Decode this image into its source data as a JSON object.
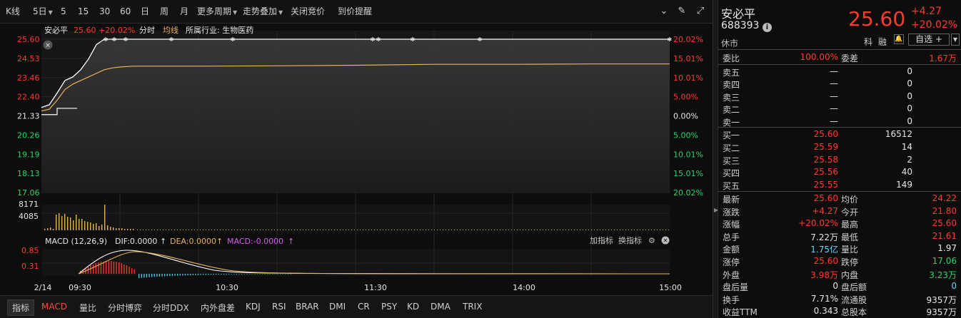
{
  "toolbar": {
    "items": [
      "K线",
      "5日",
      "5",
      "15",
      "30",
      "60",
      "日",
      "周",
      "月",
      "更多周期",
      "走势叠加",
      "关闭竞价",
      "到价提醒"
    ]
  },
  "chart_header": {
    "name": "安必平",
    "price": "25.60",
    "pct": "+20.02%",
    "mode": "分时",
    "avg_label": "均线",
    "industry": "所属行业: 生物医药"
  },
  "axes": {
    "price_ticks": [
      "25.60",
      "24.53",
      "23.46",
      "22.40",
      "21.33",
      "20.26",
      "19.19",
      "18.13",
      "17.06"
    ],
    "pct_ticks": [
      "20.02%",
      "15.01%",
      "10.01%",
      "5.00%",
      "0.00%",
      "5.00%",
      "10.01%",
      "15.01%",
      "20.02%"
    ],
    "vol_ticks": [
      "8171",
      "4085"
    ],
    "macd_ticks": [
      "0.85",
      "0.31"
    ],
    "time_ticks": [
      "2/14",
      "09:30",
      "10:30",
      "11:30",
      "14:00",
      "15:00"
    ]
  },
  "macd": {
    "title": "MACD (12,26,9)",
    "dif": "DIF:0.0000",
    "dea": "DEA:0.0000",
    "macd": "MACD:-0.0000",
    "add_indicator": "加指标",
    "switch_indicator": "换指标"
  },
  "tabs": [
    "指标",
    "MACD",
    "量比",
    "分时博弈",
    "分时DDX",
    "内外盘差",
    "KDJ",
    "RSI",
    "BRAR",
    "DMI",
    "CR",
    "PSY",
    "KD",
    "DMA",
    "TRIX"
  ],
  "panel": {
    "name": "安必平",
    "code": "688393",
    "status": "休市",
    "price": "25.60",
    "change": "+4.27",
    "change_pct": "+20.02%",
    "badge_ke": "科",
    "badge_rong": "融",
    "watch": "自选 +",
    "weibi_label": "委比",
    "weibi": "100.00%",
    "weicha_label": "委差",
    "weicha": "1.67万",
    "asks": [
      {
        "label": "卖五",
        "price": "—",
        "vol": "0"
      },
      {
        "label": "卖四",
        "price": "—",
        "vol": "0"
      },
      {
        "label": "卖三",
        "price": "—",
        "vol": "0"
      },
      {
        "label": "卖二",
        "price": "—",
        "vol": "0"
      },
      {
        "label": "卖一",
        "price": "—",
        "vol": "0"
      }
    ],
    "bids": [
      {
        "label": "买一",
        "price": "25.60",
        "vol": "16512"
      },
      {
        "label": "买二",
        "price": "25.59",
        "vol": "14"
      },
      {
        "label": "买三",
        "price": "25.58",
        "vol": "2"
      },
      {
        "label": "买四",
        "price": "25.56",
        "vol": "40"
      },
      {
        "label": "买五",
        "price": "25.55",
        "vol": "149"
      }
    ],
    "stats": [
      {
        "l1": "最新",
        "v1": "25.60",
        "c1": "red",
        "l2": "均价",
        "v2": "24.22",
        "c2": "red"
      },
      {
        "l1": "涨跌",
        "v1": "+4.27",
        "c1": "red",
        "l2": "今开",
        "v2": "21.80",
        "c2": "red"
      },
      {
        "l1": "涨幅",
        "v1": "+20.02%",
        "c1": "red",
        "l2": "最高",
        "v2": "25.60",
        "c2": "red"
      },
      {
        "l1": "总手",
        "v1": "7.22万",
        "c1": "white",
        "l2": "最低",
        "v2": "21.61",
        "c2": "red"
      },
      {
        "l1": "金额",
        "v1": "1.75亿",
        "c1": "cyan",
        "l2": "量比",
        "v2": "1.97",
        "c2": "white"
      },
      {
        "l1": "涨停",
        "v1": "25.60",
        "c1": "red",
        "l2": "跌停",
        "v2": "17.06",
        "c2": "green"
      },
      {
        "l1": "外盘",
        "v1": "3.98万",
        "c1": "red",
        "l2": "内盘",
        "v2": "3.23万",
        "c2": "green"
      },
      {
        "l1": "盘后量",
        "v1": "0",
        "c1": "white",
        "l2": "盘后额",
        "v2": "0",
        "c2": "cyan"
      },
      {
        "l1": "换手",
        "v1": "7.71%",
        "c1": "white",
        "l2": "流通股",
        "v2": "9357万",
        "c2": "white"
      },
      {
        "l1": "收益TTM",
        "v1": "0.343",
        "c1": "white",
        "l2": "总股本",
        "v2": "9357万",
        "c2": "white"
      }
    ]
  },
  "colors": {
    "up": "#ff3b30",
    "down": "#2bd468",
    "price_line": "#ffffff",
    "avg_line": "#e8b15c",
    "vol_bar": "#e8b15c",
    "macd_pos": "#ff3b30",
    "macd_neg": "#4fd0e8"
  },
  "chart_data": {
    "type": "line",
    "title": "",
    "prev_close": 21.33,
    "limit_up": 25.6,
    "limit_down": 17.06,
    "x": [
      "09:30",
      "09:33",
      "09:36",
      "09:39",
      "09:42",
      "09:45",
      "09:48",
      "09:51",
      "09:54",
      "09:57",
      "10:00",
      "10:05",
      "10:15",
      "10:30",
      "11:00",
      "11:30",
      "13:30",
      "14:00",
      "14:30",
      "15:00"
    ],
    "series": [
      {
        "name": "",
        "values": [
          21.8,
          21.95,
          22.6,
          23.3,
          23.5,
          23.9,
          24.5,
          25.3,
          25.6,
          25.6,
          25.6,
          25.6,
          25.6,
          25.6,
          25.6,
          25.6,
          25.6,
          25.6,
          25.6,
          25.6
        ]
      },
      {
        "name": "均线",
        "values": [
          21.6,
          21.7,
          22.2,
          22.8,
          23.1,
          23.3,
          23.5,
          23.7,
          23.9,
          24.0,
          24.05,
          24.1,
          24.1,
          24.1,
          24.12,
          24.15,
          24.2,
          24.2,
          24.22,
          24.22
        ]
      }
    ],
    "ylim": [
      17.06,
      25.6
    ]
  }
}
